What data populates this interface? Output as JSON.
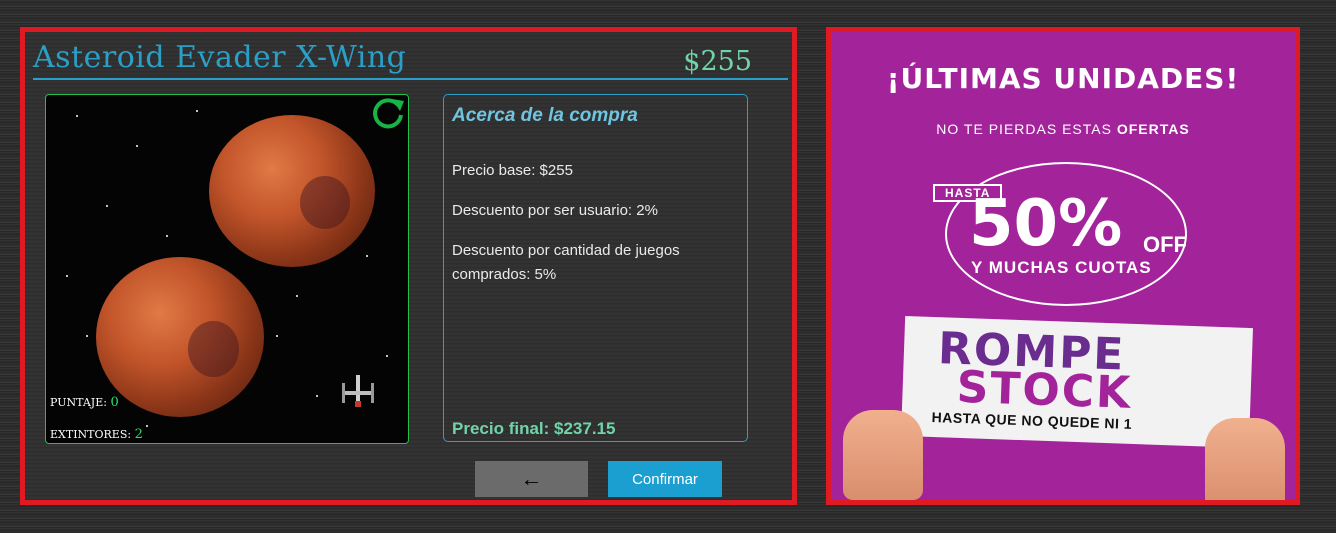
{
  "product": {
    "title": "Asteroid Evader X-Wing",
    "price": "$255"
  },
  "game": {
    "score_label": "PUNTAJE:",
    "score_value": "0",
    "extinguishers_label": "EXTINTORES:",
    "extinguishers_value": "2",
    "icons": [
      "refresh-icon",
      "xwing-ship-icon"
    ]
  },
  "about": {
    "heading": "Acerca de la compra",
    "base_price": "Precio base: $255",
    "user_discount": "Descuento por ser usuario: 2%",
    "quantity_discount": "Descuento por cantidad de juegos comprados: 5%",
    "final_price": "Precio final: $237.15"
  },
  "actions": {
    "back_label": "←",
    "confirm_label": "Confirmar"
  },
  "ad": {
    "headline": "¡ÚLTIMAS UNIDADES!",
    "subline_prefix": "NO TE PIERDAS ESTAS",
    "subline_bold": "OFERTAS",
    "hasta": "HASTA",
    "percent": "50%",
    "off": "OFF",
    "cuotas": "Y MUCHAS CUOTAS",
    "sign_line1": "ROMPE",
    "sign_line2": "STOCK",
    "sign_line3": "HASTA QUE NO QUEDE NI 1"
  },
  "colors": {
    "accent_blue": "#2a9fc7",
    "price_green": "#6fd4a8",
    "frame_red": "#e01a22",
    "ad_magenta": "#a3249a",
    "confirm_blue": "#1b9fd0"
  }
}
